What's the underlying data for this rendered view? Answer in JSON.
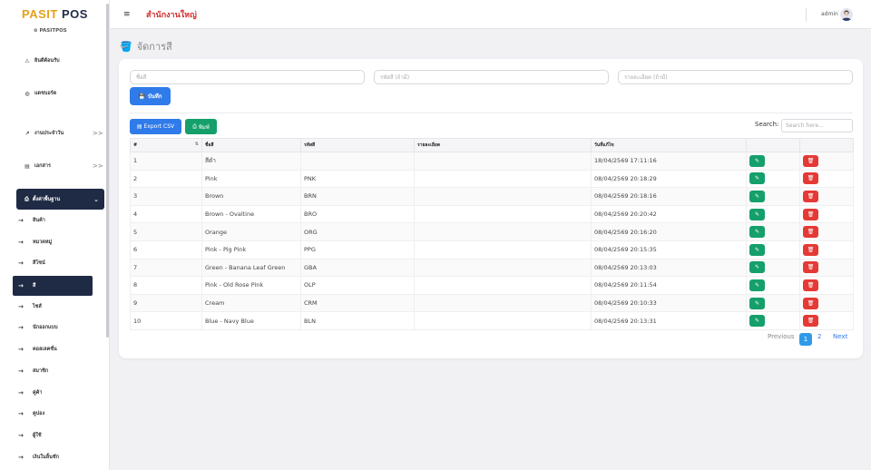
{
  "brand": {
    "part1": "PASIT",
    "part2": "POS",
    "sub": "⊚ PASITPOS"
  },
  "nav": {
    "welcome": "ยินดีต้อนรับ",
    "dashboard": "แดชบอร์ด",
    "daily": "งานประจำวัน",
    "docs": "เอกสาร",
    "settings": "ตั้งค่าพื้นฐาน",
    "chevron_right": ">>",
    "chevron_down": "⌄"
  },
  "subnav": [
    "สินค้า",
    "หมวดหมู่",
    "สีโซน์",
    "สี",
    "ไซส์",
    "นักออกแบบ",
    "คอลเลคชั่น",
    "สมาชิก",
    "คู่ค้า",
    "คูปอง",
    "ผู้ใช้",
    "เงินในลิ้นชัก"
  ],
  "topbar": {
    "branch": "สำนักงานใหญ่",
    "user": "admin"
  },
  "page": {
    "title": "จัดการสี"
  },
  "form": {
    "name_placeholder": "ชื่อสี",
    "code_placeholder": "รหัสสี (ถ้ามี)",
    "detail_placeholder": "รายละเอียด (ถ้ามี)",
    "save_label": "บันทึก"
  },
  "toolbar": {
    "csv_label": "Export CSV",
    "print_label": "พิมพ์",
    "search_label": "Search:",
    "search_placeholder": "Search here..."
  },
  "table": {
    "headers": [
      "#",
      "ชื่อสี",
      "รหัสสี",
      "รายละเอียด",
      "วันที่แก้ไข",
      "",
      ""
    ],
    "sort_indicator": "⇅",
    "rows": [
      {
        "no": "1",
        "name": "สีดำ",
        "code": "",
        "detail": "",
        "date": "18/04/2569 17:11:16"
      },
      {
        "no": "2",
        "name": "Pink",
        "code": "PNK",
        "detail": "",
        "date": "08/04/2569 20:18:29"
      },
      {
        "no": "3",
        "name": "Brown",
        "code": "BRN",
        "detail": "",
        "date": "08/04/2569 20:18:16"
      },
      {
        "no": "4",
        "name": "Brown - Ovaltine",
        "code": "BRO",
        "detail": "",
        "date": "08/04/2569 20:20:42"
      },
      {
        "no": "5",
        "name": "Orange",
        "code": "ORG",
        "detail": "",
        "date": "08/04/2569 20:16:20"
      },
      {
        "no": "6",
        "name": "Pink - Pig Pink",
        "code": "PPG",
        "detail": "",
        "date": "08/04/2569 20:15:35"
      },
      {
        "no": "7",
        "name": "Green - Banana Leaf Green",
        "code": "GBA",
        "detail": "",
        "date": "08/04/2569 20:13:03"
      },
      {
        "no": "8",
        "name": "Pink - Old Rose Pink",
        "code": "OLP",
        "detail": "",
        "date": "08/04/2569 20:11:54"
      },
      {
        "no": "9",
        "name": "Cream",
        "code": "CRM",
        "detail": "",
        "date": "08/04/2569 20:10:33"
      },
      {
        "no": "10",
        "name": "Blue - Navy Blue",
        "code": "BLN",
        "detail": "",
        "date": "08/04/2569 20:13:31"
      }
    ]
  },
  "pagination": {
    "prev": "Previous",
    "page1": "1",
    "page2": "2",
    "next": "Next"
  },
  "colors": {
    "primary": "#2f7bea",
    "success": "#15a06b",
    "danger": "#e53935",
    "navy": "#1f2a44",
    "brand_gold": "#e4a11b"
  }
}
